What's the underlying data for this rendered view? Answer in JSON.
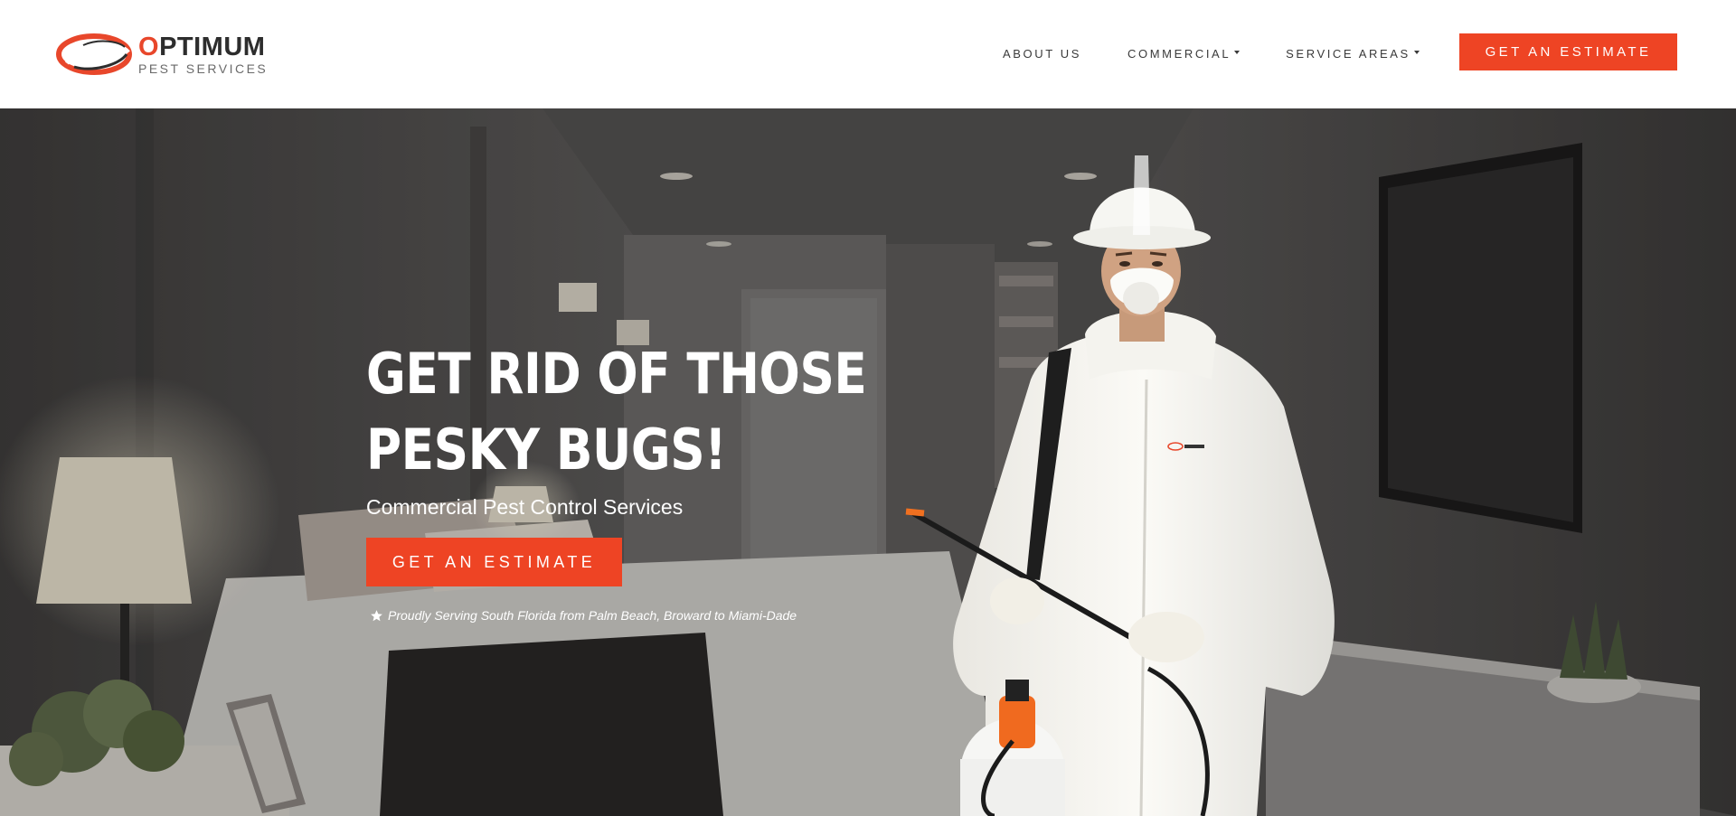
{
  "header": {
    "logo": {
      "wordmark_first_letter": "O",
      "wordmark_rest": "PTIMUM",
      "subtitle": "PEST SERVICES",
      "icon": "swoosh-ring-logo-icon"
    },
    "nav": [
      {
        "label": "ABOUT US",
        "has_dropdown": false
      },
      {
        "label": "COMMERCIAL",
        "has_dropdown": true
      },
      {
        "label": "SERVICE AREAS",
        "has_dropdown": true
      }
    ],
    "cta_label": "GET AN ESTIMATE"
  },
  "hero": {
    "headline_line1": "GET RID OF THOSE",
    "headline_line2": "PESKY BUGS!",
    "subheadline": "Commercial Pest Control Services",
    "cta_label": "GET AN ESTIMATE",
    "tagline": "Proudly Serving South Florida from Palm Beach, Broward to Miami-Dade",
    "tagline_icon": "star-icon",
    "background": "bedroom-with-pest-technician-photo"
  },
  "colors": {
    "accent": "#ee4424",
    "header_bg": "#ffffff",
    "nav_text": "#3a3a3a",
    "hero_text": "#ffffff"
  }
}
